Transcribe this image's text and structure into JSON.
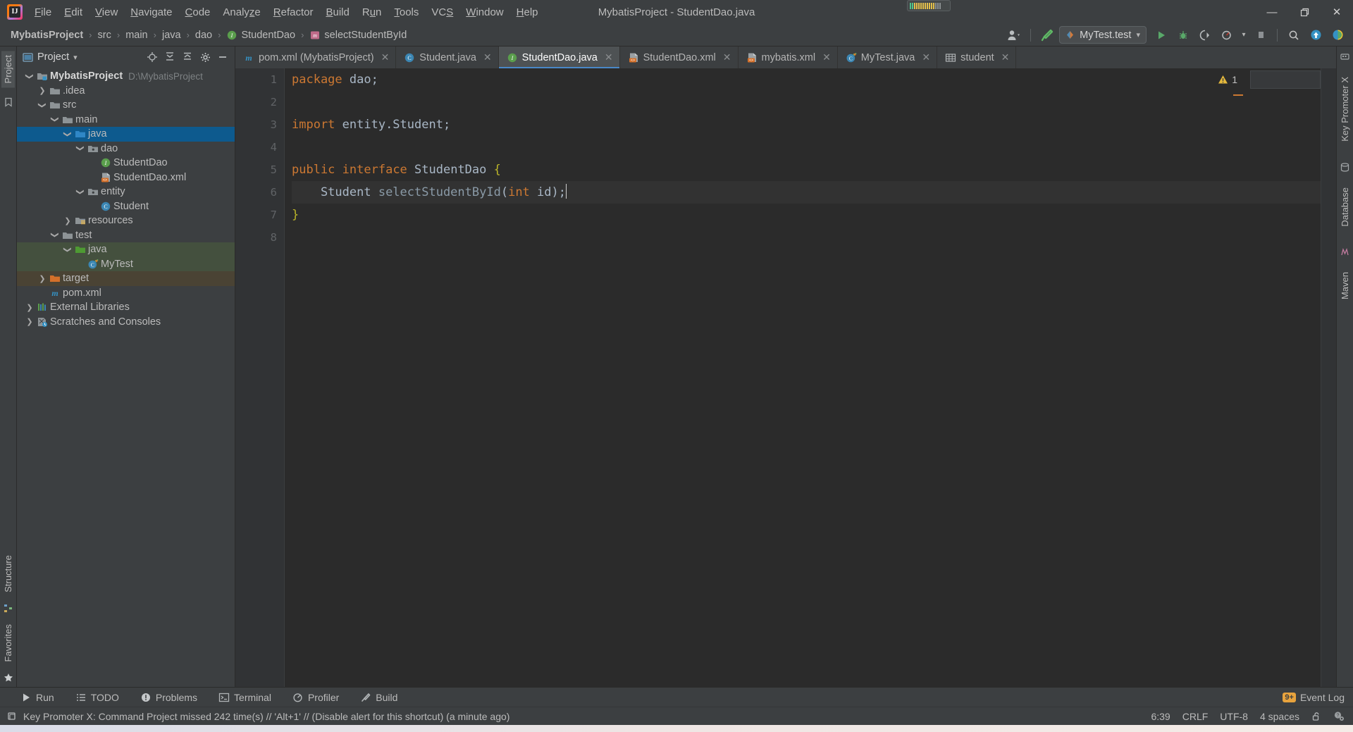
{
  "window": {
    "title": "MybatisProject - StudentDao.java",
    "controls": {
      "minimize": "—",
      "restore": "❐",
      "close": "✕"
    }
  },
  "menu": {
    "items": [
      {
        "label": "File",
        "mnemonic": "F"
      },
      {
        "label": "Edit",
        "mnemonic": "E"
      },
      {
        "label": "View",
        "mnemonic": "V"
      },
      {
        "label": "Navigate",
        "mnemonic": "N"
      },
      {
        "label": "Code",
        "mnemonic": "C"
      },
      {
        "label": "Analyze",
        "mnemonic": "z"
      },
      {
        "label": "Refactor",
        "mnemonic": "R"
      },
      {
        "label": "Build",
        "mnemonic": "B"
      },
      {
        "label": "Run",
        "mnemonic": "u"
      },
      {
        "label": "Tools",
        "mnemonic": "T"
      },
      {
        "label": "VCS",
        "mnemonic": "S"
      },
      {
        "label": "Window",
        "mnemonic": "W"
      },
      {
        "label": "Help",
        "mnemonic": "H"
      }
    ]
  },
  "breadcrumb": {
    "items": [
      {
        "label": "MybatisProject",
        "icon": null,
        "bold": true
      },
      {
        "label": "src",
        "icon": null,
        "bold": false
      },
      {
        "label": "main",
        "icon": null,
        "bold": false
      },
      {
        "label": "java",
        "icon": null,
        "bold": false
      },
      {
        "label": "dao",
        "icon": null,
        "bold": false
      },
      {
        "label": "StudentDao",
        "icon": "interface-icon",
        "bold": false
      },
      {
        "label": "selectStudentById",
        "icon": "method-icon",
        "bold": false
      }
    ],
    "separator": "›"
  },
  "toolbar": {
    "run_config": "MyTest.test",
    "dropdown_caret": "▾",
    "buttons": [
      {
        "name": "user-account-icon",
        "label": ""
      },
      {
        "name": "build-hammer-icon",
        "label": ""
      },
      {
        "name": "run-icon",
        "label": ""
      },
      {
        "name": "debug-icon",
        "label": ""
      },
      {
        "name": "run-with-coverage-icon",
        "label": ""
      },
      {
        "name": "profiler-icon",
        "label": ""
      },
      {
        "name": "stop-icon",
        "label": ""
      },
      {
        "name": "search-everywhere-icon",
        "label": ""
      },
      {
        "name": "update-project-icon",
        "label": ""
      },
      {
        "name": "ide-assistant-icon",
        "label": ""
      }
    ]
  },
  "left_strips": {
    "top": [
      {
        "label": "Project",
        "selected": true
      }
    ],
    "bottom": [
      {
        "label": "Structure",
        "selected": false
      },
      {
        "label": "Favorites",
        "selected": false
      }
    ]
  },
  "right_strips": {
    "items": [
      {
        "label": "Key Promoter X"
      },
      {
        "label": "Database"
      },
      {
        "label": "Maven"
      }
    ]
  },
  "project_panel": {
    "title": "Project",
    "title_caret": "▾",
    "actions": [
      "locate-icon",
      "expand-all-icon",
      "collapse-all-icon",
      "settings-gear-icon",
      "hide-icon"
    ],
    "tree": [
      {
        "depth": 0,
        "arrow": "down",
        "icon": "module-folder-icon",
        "label": "MybatisProject",
        "bold": true,
        "path": "D:\\MybatisProject",
        "state": "normal"
      },
      {
        "depth": 1,
        "arrow": "right",
        "icon": "folder-icon",
        "label": ".idea",
        "bold": false,
        "path": "",
        "state": "normal"
      },
      {
        "depth": 1,
        "arrow": "down",
        "icon": "folder-icon",
        "label": "src",
        "bold": false,
        "path": "",
        "state": "normal"
      },
      {
        "depth": 2,
        "arrow": "down",
        "icon": "folder-icon",
        "label": "main",
        "bold": false,
        "path": "",
        "state": "normal"
      },
      {
        "depth": 3,
        "arrow": "down",
        "icon": "source-folder-icon",
        "label": "java",
        "bold": false,
        "path": "",
        "state": "selected"
      },
      {
        "depth": 4,
        "arrow": "down",
        "icon": "package-icon",
        "label": "dao",
        "bold": false,
        "path": "",
        "state": "normal"
      },
      {
        "depth": 5,
        "arrow": "none",
        "icon": "interface-icon",
        "label": "StudentDao",
        "bold": false,
        "path": "",
        "state": "normal"
      },
      {
        "depth": 5,
        "arrow": "none",
        "icon": "xml-file-icon",
        "label": "StudentDao.xml",
        "bold": false,
        "path": "",
        "state": "normal"
      },
      {
        "depth": 4,
        "arrow": "down",
        "icon": "package-icon",
        "label": "entity",
        "bold": false,
        "path": "",
        "state": "normal"
      },
      {
        "depth": 5,
        "arrow": "none",
        "icon": "class-icon",
        "label": "Student",
        "bold": false,
        "path": "",
        "state": "normal"
      },
      {
        "depth": 3,
        "arrow": "right",
        "icon": "resources-folder-icon",
        "label": "resources",
        "bold": false,
        "path": "",
        "state": "normal"
      },
      {
        "depth": 2,
        "arrow": "down",
        "icon": "folder-icon",
        "label": "test",
        "bold": false,
        "path": "",
        "state": "normal"
      },
      {
        "depth": 3,
        "arrow": "down",
        "icon": "test-source-folder-icon",
        "label": "java",
        "bold": false,
        "path": "",
        "state": "testsrc"
      },
      {
        "depth": 4,
        "arrow": "none",
        "icon": "test-class-icon",
        "label": "MyTest",
        "bold": false,
        "path": "",
        "state": "testsrc"
      },
      {
        "depth": 1,
        "arrow": "right",
        "icon": "excluded-folder-icon",
        "label": "target",
        "bold": false,
        "path": "",
        "state": "excluded"
      },
      {
        "depth": 1,
        "arrow": "none",
        "icon": "maven-file-icon",
        "label": "pom.xml",
        "bold": false,
        "path": "",
        "state": "normal"
      },
      {
        "depth": 0,
        "arrow": "right",
        "icon": "libraries-icon",
        "label": "External Libraries",
        "bold": false,
        "path": "",
        "state": "normal"
      },
      {
        "depth": 0,
        "arrow": "right",
        "icon": "scratches-icon",
        "label": "Scratches and Consoles",
        "bold": false,
        "path": "",
        "state": "normal"
      }
    ]
  },
  "editor_tabs": [
    {
      "label": "pom.xml (MybatisProject)",
      "icon": "maven-file-icon",
      "active": false,
      "close": "✕"
    },
    {
      "label": "Student.java",
      "icon": "class-icon",
      "active": false,
      "close": "✕"
    },
    {
      "label": "StudentDao.java",
      "icon": "interface-icon",
      "active": true,
      "close": "✕"
    },
    {
      "label": "StudentDao.xml",
      "icon": "xml-file-icon",
      "active": false,
      "close": "✕"
    },
    {
      "label": "mybatis.xml",
      "icon": "xml-file-icon",
      "active": false,
      "close": "✕"
    },
    {
      "label": "MyTest.java",
      "icon": "test-class-icon",
      "active": false,
      "close": "✕"
    },
    {
      "label": "student",
      "icon": "database-table-icon",
      "active": false,
      "close": "✕"
    }
  ],
  "editor": {
    "line_numbers": [
      "1",
      "2",
      "3",
      "4",
      "5",
      "6",
      "7",
      "8"
    ],
    "lines": [
      {
        "n": 1,
        "tokens": [
          {
            "t": "package",
            "c": "kw"
          },
          {
            "t": " dao",
            "c": "plain"
          },
          {
            "t": ";",
            "c": "plain"
          }
        ]
      },
      {
        "n": 2,
        "tokens": []
      },
      {
        "n": 3,
        "tokens": [
          {
            "t": "import",
            "c": "kw"
          },
          {
            "t": " entity.Student;",
            "c": "plain"
          }
        ]
      },
      {
        "n": 4,
        "tokens": []
      },
      {
        "n": 5,
        "tokens": [
          {
            "t": "public",
            "c": "kw"
          },
          {
            "t": " ",
            "c": "plain"
          },
          {
            "t": "interface",
            "c": "kw"
          },
          {
            "t": " StudentDao ",
            "c": "plain"
          },
          {
            "t": "{",
            "c": "brace"
          }
        ]
      },
      {
        "n": 6,
        "tokens": [
          {
            "t": "    Student ",
            "c": "plain"
          },
          {
            "t": "selectStudentById",
            "c": "method"
          },
          {
            "t": "(",
            "c": "plain"
          },
          {
            "t": "int",
            "c": "kw"
          },
          {
            "t": " id);",
            "c": "plain"
          }
        ],
        "caret_line": true,
        "bulb": true
      },
      {
        "n": 7,
        "tokens": [
          {
            "t": "}",
            "c": "brace"
          }
        ]
      },
      {
        "n": 8,
        "tokens": []
      }
    ],
    "warning_count": "1",
    "warning_icon": "warning-triangle-icon",
    "prev_problem": "˄",
    "next_problem": "˅"
  },
  "bottom_toolbar": {
    "items": [
      {
        "label": "Run",
        "icon": "run-icon"
      },
      {
        "label": "TODO",
        "icon": "todo-icon"
      },
      {
        "label": "Problems",
        "icon": "problems-icon"
      },
      {
        "label": "Terminal",
        "icon": "terminal-icon"
      },
      {
        "label": "Profiler",
        "icon": "profiler-icon"
      },
      {
        "label": "Build",
        "icon": "build-icon"
      }
    ],
    "event_log": {
      "label": "Event Log",
      "badge": "9+"
    }
  },
  "status_bar": {
    "message": "Key Promoter X: Command Project missed 242 time(s) // 'Alt+1' // (Disable alert for this shortcut) (a minute ago)",
    "message_icon": "notification-icon",
    "caret_position": "6:39",
    "line_separator": "CRLF",
    "encoding": "UTF-8",
    "indent": "4 spaces",
    "lock_icon": "unlocked-icon",
    "inspection_icon": "inspection-settings-icon"
  },
  "colors": {
    "accent_blue": "#4a88c7",
    "selection_blue": "#0d5a8e",
    "test_green": "#44503e",
    "excluded_brown": "#4a4334",
    "keyword_orange": "#cc7832",
    "text_gray": "#a9b7c6",
    "brace_yellow": "#bbb529",
    "panel_bg": "#3c3f41",
    "editor_bg": "#2b2b2b"
  }
}
